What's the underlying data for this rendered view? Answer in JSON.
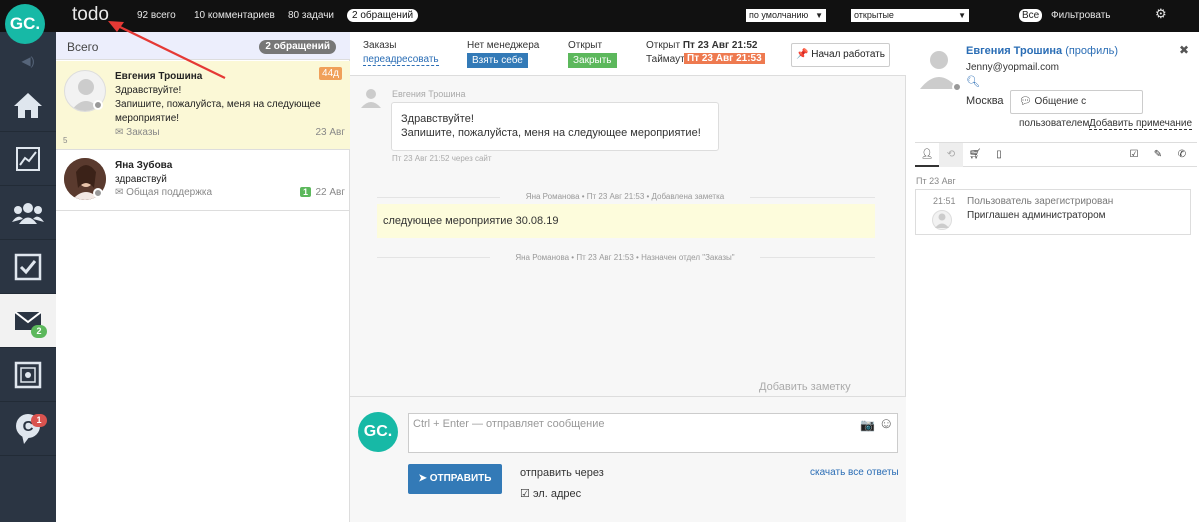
{
  "topbar": {
    "logo": "GC.",
    "title": "todo",
    "stats": [
      "92 всего",
      "10 комментариев",
      "80 задачи"
    ],
    "badge": "2 обращений",
    "sort_select": "по умолчанию",
    "status_select": "открытые",
    "all_label": "Все",
    "filter_label": "Фильтровать"
  },
  "sidebar": {
    "items": [
      {
        "icon": "home-icon"
      },
      {
        "icon": "chart-icon"
      },
      {
        "icon": "users-icon"
      },
      {
        "icon": "checkbox-icon"
      },
      {
        "icon": "mail-icon",
        "badge": "2"
      },
      {
        "icon": "safe-icon"
      },
      {
        "icon": "chat-icon",
        "badge": "1"
      }
    ]
  },
  "list": {
    "header_label": "Всего",
    "header_badge": "2 обращений",
    "rows": [
      {
        "name": "Евгения Трошина",
        "text": "Здравствуйте!\nЗапишите, пожалуйста, меня на следующее мероприятие!",
        "channel": "Заказы",
        "date": "23 Авг",
        "age": "44д",
        "index": "5"
      },
      {
        "name": "Яна Зубова",
        "text": "здравствуй",
        "channel": "Общая поддержка",
        "date": "22 Авг",
        "count": "1"
      }
    ]
  },
  "chat_header": {
    "dept_label": "Заказы",
    "redirect_link": "переадресовать",
    "manager_label": "Нет менеджера",
    "take_button": "Взять себе",
    "status_label": "Открыт",
    "close_button": "Закрыть",
    "opened_label": "Открыт",
    "opened_value": "Пт 23 Авг 21:52",
    "timeout_label": "Таймаут",
    "timeout_value": "Пт 23 Авг 21:53",
    "start_button": "Начал работать"
  },
  "messages": {
    "author": "Евгения Трошина",
    "text_line1": "Здравствуйте!",
    "text_line2": "Запишите, пожалуйста, меня на следующее мероприятие!",
    "meta": "Пт 23 Авг 21:52 через сайт",
    "note_meta": "Яна Романова • Пт 23 Авг 21:53 • Добавлена заметка",
    "note_text": "следующее мероприятие 30.08.19",
    "assign_meta": "Яна Романова • Пт 23 Авг 21:53 • Назначен отдел \"Заказы\"",
    "add_note": "Добавить заметку"
  },
  "composer": {
    "logo": "GC.",
    "placeholder": "Ctrl + Enter — отправляет сообщение",
    "send_button": "ОТПРАВИТЬ",
    "send_via": "отправить через",
    "email_option": "эл. адрес",
    "download_link": "скачать все ответы"
  },
  "profile": {
    "name": "Евгения Трошина",
    "profile_link": "(профиль)",
    "email": "Jenny@yopmail.com",
    "city": "Москва",
    "chat_button": "Общение с пользователем",
    "add_note_link": "Добавить примечание",
    "history_date": "Пт 23 Авг",
    "history_time": "21:51",
    "history_event": "Пользователь зарегистрирован",
    "history_detail": "Приглашен администратором"
  },
  "colors": {
    "accent": "#17b9a6",
    "sidebar": "#2b3543",
    "highlight": "#fbf8d6",
    "timeout": "#ee7a50",
    "green": "#5cb85c",
    "blue": "#337ab7"
  }
}
